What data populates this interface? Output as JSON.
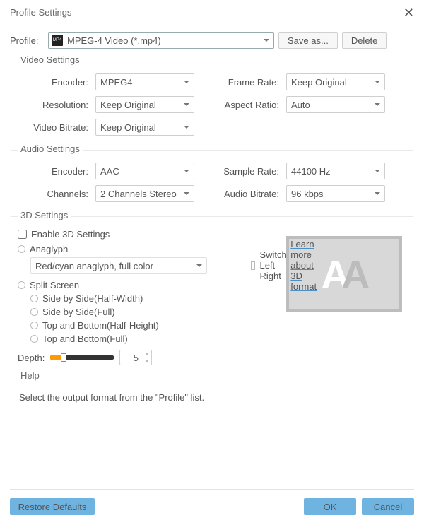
{
  "title": "Profile Settings",
  "profile": {
    "label": "Profile:",
    "value": "MPEG-4 Video (*.mp4)",
    "save_as": "Save as...",
    "delete": "Delete"
  },
  "video": {
    "legend": "Video Settings",
    "encoder": {
      "label": "Encoder:",
      "value": "MPEG4"
    },
    "resolution": {
      "label": "Resolution:",
      "value": "Keep Original"
    },
    "bitrate": {
      "label": "Video Bitrate:",
      "value": "Keep Original"
    },
    "frame_rate": {
      "label": "Frame Rate:",
      "value": "Keep Original"
    },
    "aspect_ratio": {
      "label": "Aspect Ratio:",
      "value": "Auto"
    }
  },
  "audio": {
    "legend": "Audio Settings",
    "encoder": {
      "label": "Encoder:",
      "value": "AAC"
    },
    "channels": {
      "label": "Channels:",
      "value": "2 Channels Stereo"
    },
    "sample_rate": {
      "label": "Sample Rate:",
      "value": "44100 Hz"
    },
    "bitrate": {
      "label": "Audio Bitrate:",
      "value": "96 kbps"
    }
  },
  "d3": {
    "legend": "3D Settings",
    "enable": "Enable 3D Settings",
    "anaglyph": "Anaglyph",
    "anaglyph_sel": "Red/cyan anaglyph, full color",
    "split": "Split Screen",
    "sbs_half": "Side by Side(Half-Width)",
    "sbs_full": "Side by Side(Full)",
    "tab_half": "Top and Bottom(Half-Height)",
    "tab_full": "Top and Bottom(Full)",
    "depth_label": "Depth:",
    "depth_value": "5",
    "switch_lr": "Switch Left Right",
    "learn_more": "Learn more about 3D format"
  },
  "help": {
    "legend": "Help",
    "text": "Select the output format from the \"Profile\" list."
  },
  "buttons": {
    "restore": "Restore Defaults",
    "ok": "OK",
    "cancel": "Cancel"
  }
}
